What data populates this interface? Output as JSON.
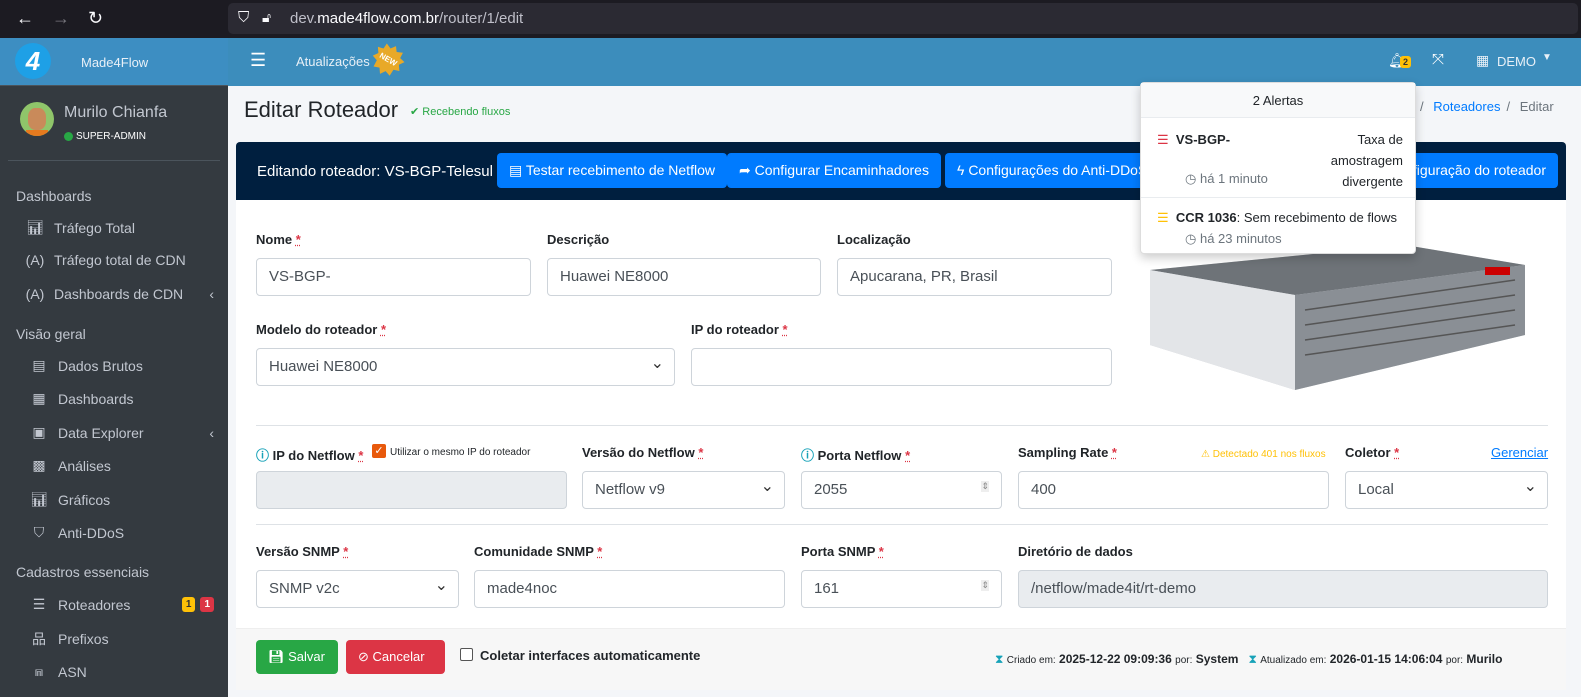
{
  "browser": {
    "url_prefix": "dev.",
    "url_domain": "made4flow.com.br",
    "url_path": "/router/1/edit"
  },
  "brand": {
    "name": "Made4Flow"
  },
  "topnav": {
    "updates": "Atualizações",
    "new_badge": "NEW",
    "bell_count": "2",
    "tenant": "DEMO"
  },
  "user": {
    "name": "Murilo Chianfa",
    "role": "SUPER-ADMIN"
  },
  "sidebar": {
    "sections": [
      {
        "title": "Dashboards",
        "items": [
          {
            "label": "Tráfego Total",
            "icon": "chart-bar-icon"
          },
          {
            "label": "Tráfego total de CDN",
            "icon": "broadcast-icon"
          },
          {
            "label": "Dashboards de CDN",
            "icon": "broadcast-icon"
          }
        ]
      },
      {
        "title": "Visão geral",
        "items": [
          {
            "label": "Dados Brutos",
            "icon": "file-icon"
          },
          {
            "label": "Dashboards",
            "icon": "calendar-icon"
          },
          {
            "label": "Data Explorer",
            "icon": "explorer-icon"
          },
          {
            "label": "Análises",
            "icon": "grid-icon"
          },
          {
            "label": "Gráficos",
            "icon": "chart-icon"
          },
          {
            "label": "Anti-DDoS",
            "icon": "shield-icon"
          }
        ]
      },
      {
        "title": "Cadastros essenciais",
        "items": [
          {
            "label": "Roteadores",
            "icon": "server-icon",
            "badges": [
              "1",
              "1"
            ]
          },
          {
            "label": "Prefixos",
            "icon": "network-icon"
          },
          {
            "label": "ASN",
            "icon": "ethernet-icon"
          }
        ]
      }
    ]
  },
  "page": {
    "title": "Editar Roteador",
    "status": "Recebendo fluxos",
    "breadcrumb": [
      "Roteadores",
      "Editar"
    ]
  },
  "card": {
    "header": "Editando roteador: VS-BGP-Telesul",
    "buttons": [
      "Testar recebimento de Netflow",
      "Configurar Encaminhadores",
      "Configurações do Anti-DDoS",
      "Configuração do roteador"
    ]
  },
  "form": {
    "nome": {
      "label": "Nome",
      "value": "VS-BGP-"
    },
    "descricao": {
      "label": "Descrição",
      "value": "Huawei NE8000"
    },
    "localizacao": {
      "label": "Localização",
      "value": "Apucarana, PR, Brasil"
    },
    "modelo": {
      "label": "Modelo do roteador",
      "value": "Huawei NE8000"
    },
    "ip": {
      "label": "IP do roteador",
      "value": ""
    },
    "ip_netflow": {
      "label": "IP do Netflow",
      "checkbox": "Utilizar o mesmo IP do roteador",
      "checked": true,
      "value": ""
    },
    "versao_netflow": {
      "label": "Versão do Netflow",
      "value": "Netflow v9"
    },
    "porta_netflow": {
      "label": "Porta Netflow",
      "value": "2055"
    },
    "sampling": {
      "label": "Sampling Rate",
      "value": "400",
      "warning": "Detectado 401 nos fluxos"
    },
    "coletor": {
      "label": "Coletor",
      "value": "Local",
      "link": "Gerenciar"
    },
    "versao_snmp": {
      "label": "Versão SNMP",
      "value": "SNMP v2c"
    },
    "comunidade": {
      "label": "Comunidade SNMP",
      "value": "made4noc"
    },
    "porta_snmp": {
      "label": "Porta SNMP",
      "value": "161"
    },
    "diretorio": {
      "label": "Diretório de dados",
      "value": "/netflow/made4it/rt-demo"
    }
  },
  "footer": {
    "save": "Salvar",
    "cancel": "Cancelar",
    "auto_collect": "Coletar interfaces automaticamente",
    "created_label": "Criado em:",
    "created": "2025-12-22 09:09:36",
    "by": "por:",
    "created_by": "System",
    "updated_label": "Atualizado em:",
    "updated": "2026-01-15 14:06:04",
    "updated_by": "Murilo"
  },
  "alerts": {
    "title": "2 Alertas",
    "items": [
      {
        "name": "VS-BGP-",
        "msg": "Taxa de amostragem divergente",
        "time": "há 1 minuto",
        "color": "#dc3545"
      },
      {
        "name": "CCR 1036",
        "msg": ": Sem recebimento de flows",
        "time": "há 23 minutos",
        "color": "#ffc107"
      }
    ]
  }
}
